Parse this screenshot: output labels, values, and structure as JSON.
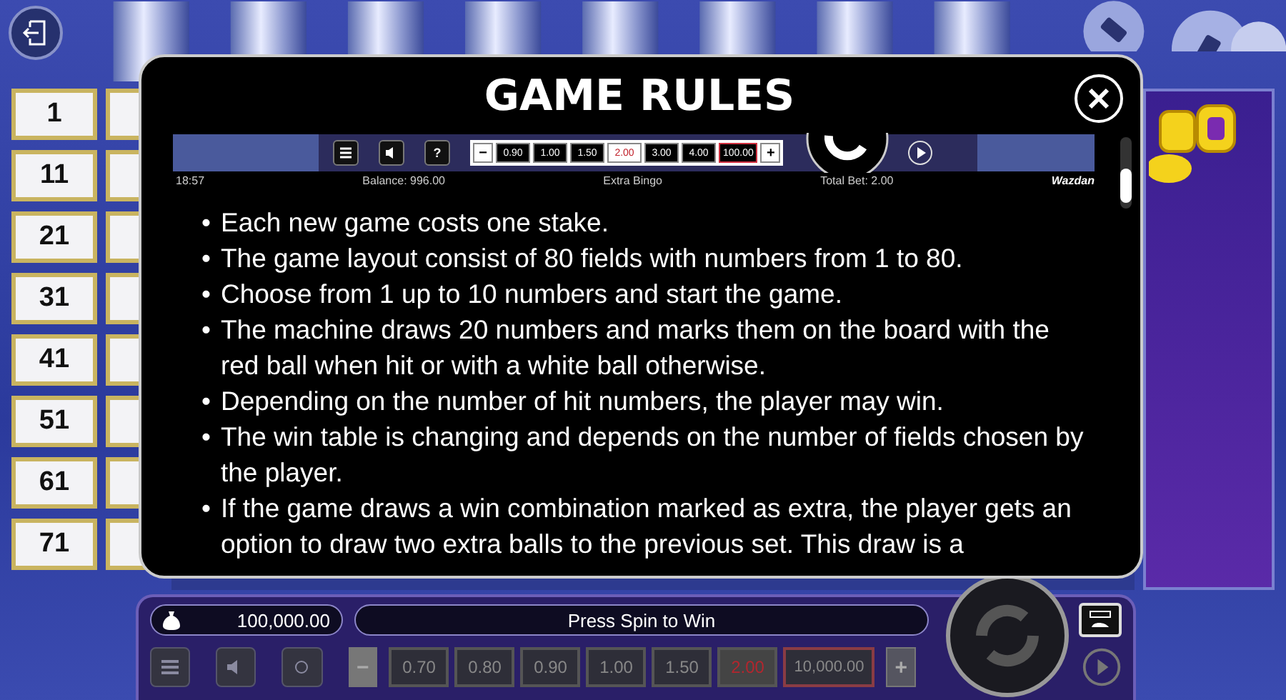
{
  "board": {
    "numbers": [
      "1",
      "11",
      "21",
      "31",
      "41",
      "51",
      "61",
      "71"
    ]
  },
  "modal": {
    "title": "GAME RULES",
    "preview": {
      "bets": [
        {
          "label": "0.90",
          "selected": false,
          "kind": "value"
        },
        {
          "label": "1.00",
          "selected": false,
          "kind": "value"
        },
        {
          "label": "1.50",
          "selected": false,
          "kind": "value"
        },
        {
          "label": "2.00",
          "selected": true,
          "kind": "value"
        },
        {
          "label": "3.00",
          "selected": false,
          "kind": "value"
        },
        {
          "label": "4.00",
          "selected": false,
          "kind": "value"
        },
        {
          "label": "100.00",
          "selected": false,
          "kind": "max"
        }
      ],
      "help_label": "?",
      "minus": "−",
      "plus": "+",
      "time": "18:57",
      "balance": "Balance: 996.00",
      "game_name": "Extra Bingo",
      "total_bet": "Total Bet: 2.00",
      "brand": "Wazdan"
    },
    "bullet": "•",
    "rules": [
      "Each new game costs one stake.",
      "The game layout consist of 80 fields with numbers from 1 to 80.",
      "Choose from 1 up to 10 numbers and start the game.",
      "The machine draws 20 numbers and marks them on the board with the red ball when hit or with a white ball otherwise.",
      "Depending on the number of hit numbers, the player may win.",
      "The win table is changing and depends on the number of fields chosen by the player.",
      "If the game draws a win combination marked as extra, the player gets an option to draw two extra balls to the previous set. This draw is a"
    ]
  },
  "panel": {
    "balance": "100,000.00",
    "message": "Press Spin to Win",
    "minus": "−",
    "plus": "+",
    "bets": [
      {
        "label": "0.70",
        "selected": false,
        "kind": "value"
      },
      {
        "label": "0.80",
        "selected": false,
        "kind": "value"
      },
      {
        "label": "0.90",
        "selected": false,
        "kind": "value"
      },
      {
        "label": "1.00",
        "selected": false,
        "kind": "value"
      },
      {
        "label": "1.50",
        "selected": false,
        "kind": "value"
      },
      {
        "label": "2.00",
        "selected": true,
        "kind": "value"
      },
      {
        "label": "10,000.00",
        "selected": false,
        "kind": "max"
      }
    ]
  }
}
